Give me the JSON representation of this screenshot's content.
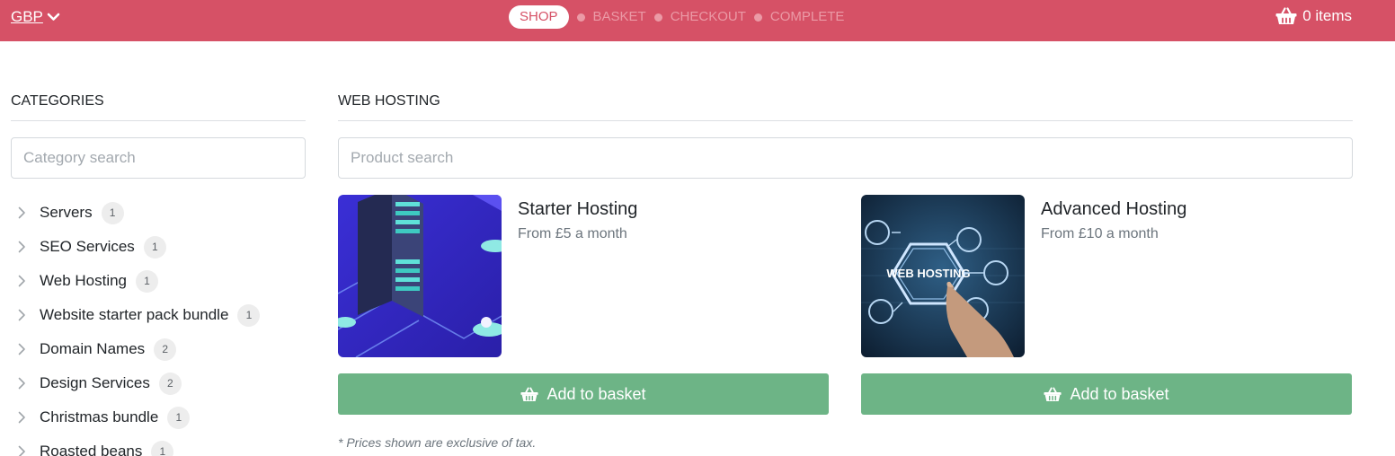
{
  "header": {
    "currency": "GBP",
    "steps": [
      "SHOP",
      "BASKET",
      "CHECKOUT",
      "COMPLETE"
    ],
    "active_step": "SHOP",
    "basket_count": "0 items",
    "colors": {
      "bar": "#d65166",
      "active_text": "#d65166",
      "inactive_step": "#eb9aa6"
    }
  },
  "sidebar": {
    "title": "CATEGORIES",
    "search_placeholder": "Category search",
    "categories": [
      {
        "label": "Servers",
        "count": "1"
      },
      {
        "label": "SEO Services",
        "count": "1"
      },
      {
        "label": "Web Hosting",
        "count": "1"
      },
      {
        "label": "Website starter pack bundle",
        "count": "1"
      },
      {
        "label": "Domain Names",
        "count": "2"
      },
      {
        "label": "Design Services",
        "count": "2"
      },
      {
        "label": "Christmas bundle",
        "count": "1"
      },
      {
        "label": "Roasted beans",
        "count": "1"
      }
    ]
  },
  "main": {
    "title": "WEB HOSTING",
    "search_placeholder": "Product search",
    "products": [
      {
        "name": "Starter Hosting",
        "price": "From £5 a month",
        "button_label": "Add to basket",
        "image_icon": "isometric-server-illustration"
      },
      {
        "name": "Advanced Hosting",
        "price": "From £10 a month",
        "button_label": "Add to basket",
        "image_icon": "web-hosting-touch-illustration",
        "image_text": "WEB HOSTING"
      }
    ],
    "tax_note": "* Prices shown are exclusive of tax.",
    "button_color": "#6db486"
  }
}
